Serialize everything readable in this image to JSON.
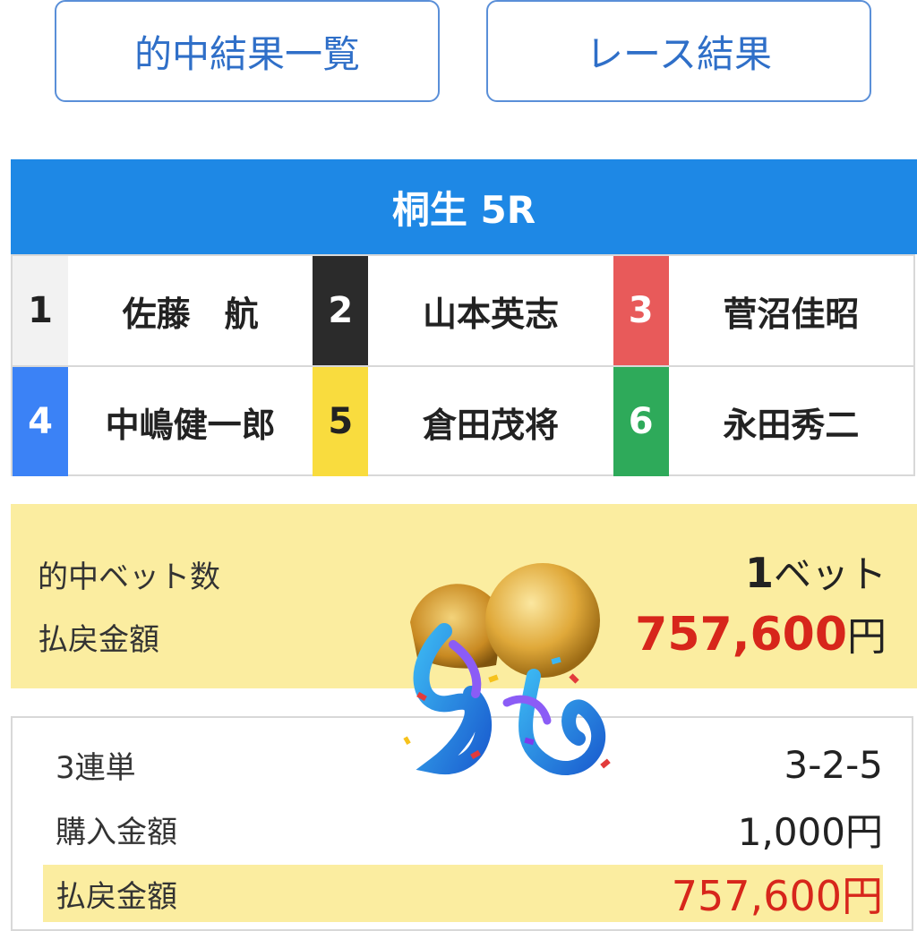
{
  "buttons": {
    "hits_list": "的中結果一覧",
    "race_results": "レース結果"
  },
  "race": {
    "title": "桐生 5R"
  },
  "entries": [
    {
      "num": "1",
      "name": "佐藤　航",
      "bg": "#f2f2f2",
      "fg": "#222222"
    },
    {
      "num": "2",
      "name": "山本英志",
      "bg": "#2b2b2b",
      "fg": "#ffffff"
    },
    {
      "num": "3",
      "name": "菅沼佳昭",
      "bg": "#e85a5a",
      "fg": "#ffffff"
    },
    {
      "num": "4",
      "name": "中嶋健一郎",
      "bg": "#3b82f6",
      "fg": "#ffffff"
    },
    {
      "num": "5",
      "name": "倉田茂将",
      "bg": "#f9dc3e",
      "fg": "#222222"
    },
    {
      "num": "6",
      "name": "永田秀二",
      "bg": "#2eaa5a",
      "fg": "#ffffff"
    }
  ],
  "summary": {
    "hit_bets_label": "的中ベット数",
    "hit_bets_number": "1",
    "hit_bets_unit": "ベット",
    "payout_label": "払戻金額",
    "payout_value": "757,600",
    "payout_unit": "円"
  },
  "detail": {
    "bet_type": "3連単",
    "combination": "3-2-5",
    "purchase_label": "購入金額",
    "purchase_value": "1,000円",
    "payout_label": "払戻金額",
    "payout_value": "757,600円"
  },
  "icons": {
    "celebration": "party-popper-icon"
  }
}
